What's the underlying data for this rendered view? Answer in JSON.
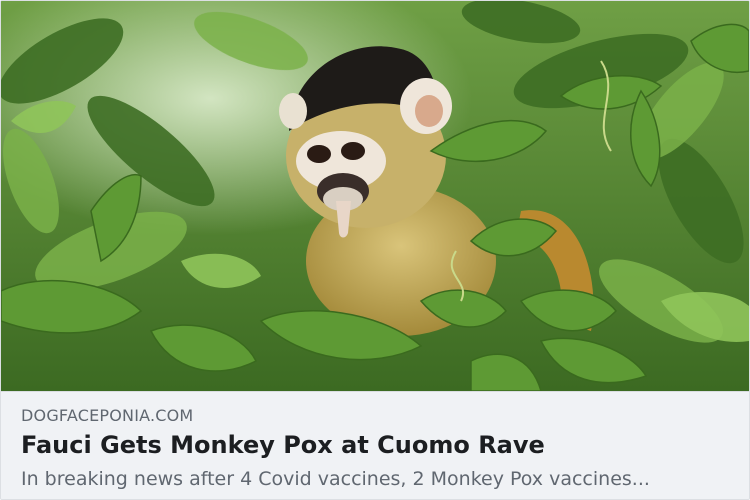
{
  "link_preview": {
    "domain": "DOGFACEPONIA.COM",
    "title": "Fauci Gets Monkey Pox at Cuomo Rave",
    "description": "In breaking news after 4 Covid vaccines, 2 Monkey Pox vaccines..."
  },
  "image": {
    "subject": "squirrel-monkey-in-green-leaves",
    "colors": {
      "leaf_dark": "#2f5a1c",
      "leaf_mid": "#5e9a34",
      "leaf_light": "#8fc45a",
      "fur_yellow": "#c9b463",
      "cap_black": "#1e1b18",
      "face_white": "#efe6da"
    }
  }
}
